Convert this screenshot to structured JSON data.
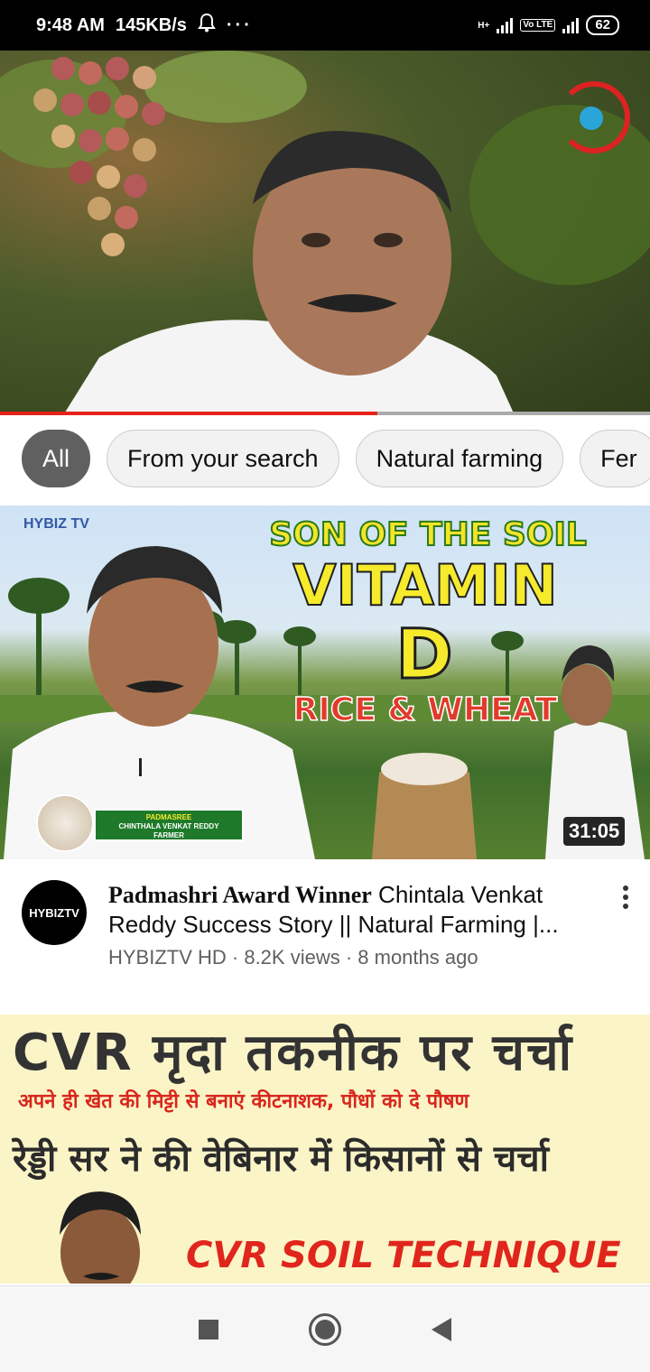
{
  "status_bar": {
    "time": "9:48 AM",
    "speed": "145KB/s",
    "battery": "62",
    "network_label": "H+",
    "volte_label": "Vo LTE"
  },
  "player": {
    "progress_fraction": 0.58
  },
  "chips": [
    {
      "label": "All",
      "active": true
    },
    {
      "label": "From your search",
      "active": false
    },
    {
      "label": "Natural farming",
      "active": false
    },
    {
      "label": "Fer",
      "active": false
    }
  ],
  "video1": {
    "thumbnail": {
      "brand": "HYBIZ TV",
      "line1": "SON OF THE SOIL",
      "line2": "VITAMIN",
      "line3": "D",
      "line4": "RICE & WHEAT",
      "badge_line1": "PADMASREE",
      "badge_line2": "CHINTHALA VENKAT REDDY",
      "badge_line3": "FARMER",
      "duration": "31:05"
    },
    "avatar_text": "HYBIZTV",
    "title_serif": "Padmashri Award Winner",
    "title_rest": " Chintala Venkat Reddy Success Story || Natural Farming |...",
    "meta": "HYBIZTV HD · 8.2K views · 8 months ago"
  },
  "video2": {
    "thumbnail": {
      "line1": "CVR मृदा तकनीक पर चर्चा",
      "line2": "अपने ही खेत की मिट्टी से बनाएं कीटनाशक, पौधों को दे पौषण",
      "line3": "रेड्डी सर ने की वेबिनार में किसानों से चर्चा",
      "line4": "CVR SOIL TECHNIQUE"
    }
  },
  "colors": {
    "progress": "#e62117",
    "chip_active_bg": "#606060",
    "chip_bg": "#f2f2f2"
  }
}
